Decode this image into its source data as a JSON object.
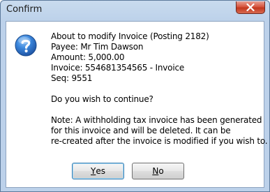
{
  "window": {
    "title": "Confirm"
  },
  "icons": {
    "question": "question-icon",
    "close": "close-icon"
  },
  "message": {
    "lines": [
      "About to modify Invoice (Posting 2182)",
      "Payee: Mr Tim Dawson",
      "Amount: 5,000.00",
      "Invoice: 554681354565 - Invoice",
      "Seq: 9551"
    ],
    "prompt": "Do you wish to continue?",
    "note_lines": [
      "Note: A withholding tax invoice has been generated",
      "for this invoice and will be deleted.  It can be",
      "re-created after the invoice is modified if you wish to."
    ]
  },
  "buttons": {
    "yes": {
      "accel": "Y",
      "rest": "es"
    },
    "no": {
      "accel": "N",
      "rest": "o"
    }
  },
  "colors": {
    "frame": "#bcd1ea",
    "close_button": "#c2381f",
    "question_icon": "#2a6fc9"
  }
}
